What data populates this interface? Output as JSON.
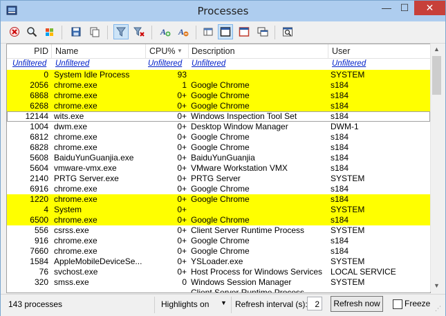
{
  "window": {
    "title": "Processes",
    "min_glyph": "—",
    "max_glyph": "☐",
    "close_glyph": "✕"
  },
  "columns": {
    "pid": "PID",
    "name": "Name",
    "cpu": "CPU%",
    "cpu_sort": "▼",
    "desc": "Description",
    "user": "User"
  },
  "filter_text": "Unfiltered",
  "rows": [
    {
      "pid": "0",
      "name": "System Idle Process",
      "cpu": "93",
      "desc": "",
      "user": "SYSTEM",
      "hl": true
    },
    {
      "pid": "2056",
      "name": "chrome.exe",
      "cpu": "1",
      "desc": "Google Chrome",
      "user": "s184",
      "hl": true
    },
    {
      "pid": "6868",
      "name": "chrome.exe",
      "cpu": "0+",
      "desc": "Google Chrome",
      "user": "s184",
      "hl": true
    },
    {
      "pid": "6268",
      "name": "chrome.exe",
      "cpu": "0+",
      "desc": "Google Chrome",
      "user": "s184",
      "hl": true
    },
    {
      "pid": "12144",
      "name": "wits.exe",
      "cpu": "0+",
      "desc": "Windows Inspection Tool Set",
      "user": "s184",
      "sel": true
    },
    {
      "pid": "1004",
      "name": "dwm.exe",
      "cpu": "0+",
      "desc": "Desktop Window Manager",
      "user": "DWM-1"
    },
    {
      "pid": "6812",
      "name": "chrome.exe",
      "cpu": "0+",
      "desc": "Google Chrome",
      "user": "s184"
    },
    {
      "pid": "6828",
      "name": "chrome.exe",
      "cpu": "0+",
      "desc": "Google Chrome",
      "user": "s184"
    },
    {
      "pid": "5608",
      "name": "BaiduYunGuanjia.exe",
      "cpu": "0+",
      "desc": "BaiduYunGuanjia",
      "user": "s184"
    },
    {
      "pid": "5604",
      "name": "vmware-vmx.exe",
      "cpu": "0+",
      "desc": "VMware Workstation VMX",
      "user": "s184"
    },
    {
      "pid": "2140",
      "name": "PRTG Server.exe",
      "cpu": "0+",
      "desc": "PRTG Server",
      "user": "SYSTEM"
    },
    {
      "pid": "6916",
      "name": "chrome.exe",
      "cpu": "0+",
      "desc": "Google Chrome",
      "user": "s184"
    },
    {
      "pid": "1220",
      "name": "chrome.exe",
      "cpu": "0+",
      "desc": "Google Chrome",
      "user": "s184",
      "hl": true
    },
    {
      "pid": "4",
      "name": "System",
      "cpu": "0+",
      "desc": "",
      "user": "SYSTEM",
      "hl": true
    },
    {
      "pid": "6500",
      "name": "chrome.exe",
      "cpu": "0+",
      "desc": "Google Chrome",
      "user": "s184",
      "hl": true
    },
    {
      "pid": "556",
      "name": "csrss.exe",
      "cpu": "0+",
      "desc": "Client Server Runtime Process",
      "user": "SYSTEM"
    },
    {
      "pid": "916",
      "name": "chrome.exe",
      "cpu": "0+",
      "desc": "Google Chrome",
      "user": "s184"
    },
    {
      "pid": "7660",
      "name": "chrome.exe",
      "cpu": "0+",
      "desc": "Google Chrome",
      "user": "s184"
    },
    {
      "pid": "1584",
      "name": "AppleMobileDeviceSe...",
      "cpu": "0+",
      "desc": "YSLoader.exe",
      "user": "SYSTEM"
    },
    {
      "pid": "76",
      "name": "svchost.exe",
      "cpu": "0+",
      "desc": "Host Process for Windows Services",
      "user": "LOCAL SERVICE"
    },
    {
      "pid": "320",
      "name": "smss.exe",
      "cpu": "0",
      "desc": "Windows Session Manager",
      "user": "SYSTEM"
    },
    {
      "pid": "",
      "name": "",
      "cpu": "",
      "desc": "Client Server Runtime Process",
      "user": ""
    }
  ],
  "status": {
    "count": "143 processes",
    "highlights": "Highlights on",
    "refresh_label": "Refresh interval (s):",
    "refresh_value": "2",
    "refresh_button": "Refresh now",
    "freeze": "Freeze"
  },
  "colors": {
    "highlight": "#ffff00",
    "link": "#0020c8",
    "close": "#c7403a"
  }
}
